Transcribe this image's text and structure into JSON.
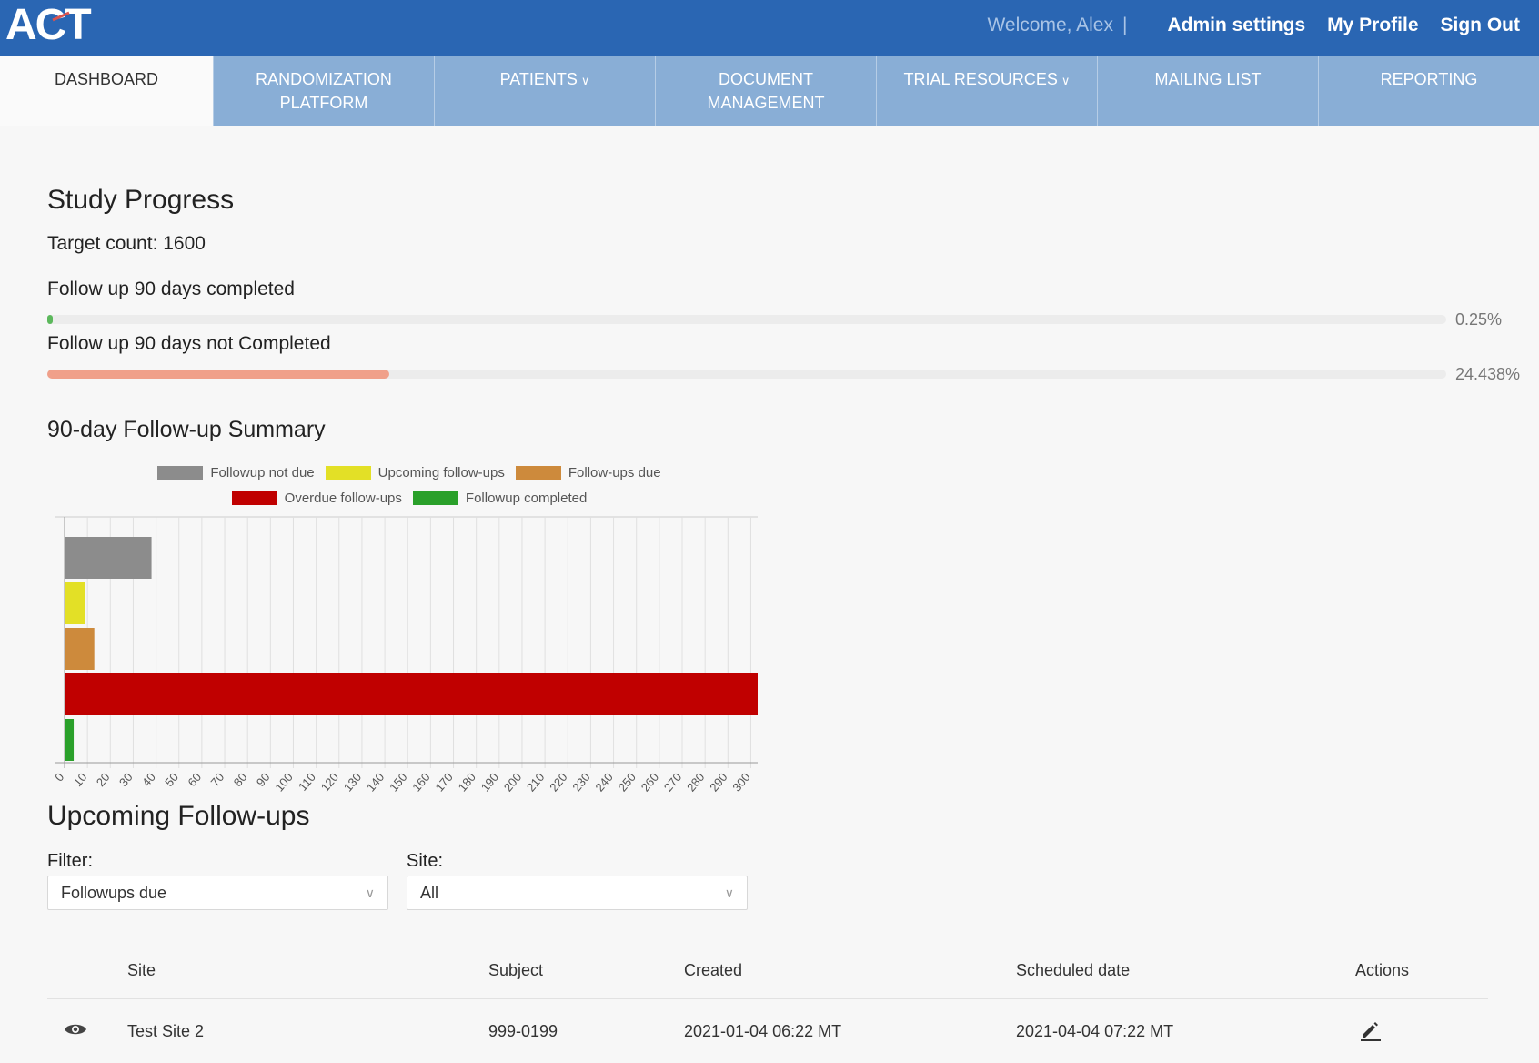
{
  "app": {
    "logo_text": "ACT",
    "welcome": "Welcome, Alex",
    "separator": "|",
    "links": [
      "Admin settings",
      "My Profile",
      "Sign Out"
    ]
  },
  "nav": {
    "items": [
      {
        "label_1": "DASHBOARD",
        "label_2": "",
        "chevron": false,
        "active": true
      },
      {
        "label_1": "RANDOMIZATION",
        "label_2": "PLATFORM",
        "chevron": false,
        "active": false
      },
      {
        "label_1": "PATIENTS",
        "label_2": "",
        "chevron": true,
        "active": false
      },
      {
        "label_1": "DOCUMENT",
        "label_2": "MANAGEMENT",
        "chevron": false,
        "active": false
      },
      {
        "label_1": "TRIAL RESOURCES",
        "label_2": "",
        "chevron": true,
        "active": false
      },
      {
        "label_1": "MAILING LIST",
        "label_2": "",
        "chevron": false,
        "active": false
      },
      {
        "label_1": "REPORTING",
        "label_2": "",
        "chevron": false,
        "active": false
      }
    ]
  },
  "progress": {
    "title": "Study Progress",
    "target": "Target count: 1600",
    "bars": [
      {
        "label": "Follow up 90 days completed",
        "percent": 0.25,
        "percent_text": "0.25%",
        "color": "#5cb85c"
      },
      {
        "label": "Follow up 90 days not Completed",
        "percent": 24.438,
        "percent_text": "24.438%",
        "color": "#f0a08a"
      }
    ]
  },
  "summary": {
    "title": "90-day Follow-up Summary"
  },
  "chart_data": {
    "type": "bar",
    "orientation": "horizontal",
    "categories": [
      "Followup not due",
      "Upcoming follow-ups",
      "Follow-ups due",
      "Overdue follow-ups",
      "Followup completed"
    ],
    "series": [
      {
        "name": "Followup not due",
        "values": [
          38
        ],
        "color": "#8c8c8c"
      },
      {
        "name": "Upcoming follow-ups",
        "values": [
          9
        ],
        "color": "#e3e026"
      },
      {
        "name": "Follow-ups due",
        "values": [
          13
        ],
        "color": "#cd8a3c"
      },
      {
        "name": "Overdue follow-ups",
        "values": [
          303
        ],
        "color": "#c00000"
      },
      {
        "name": "Followup completed",
        "values": [
          4
        ],
        "color": "#2aa02a"
      }
    ],
    "xticks": [
      0,
      10,
      20,
      30,
      40,
      50,
      60,
      70,
      80,
      90,
      100,
      110,
      120,
      130,
      140,
      150,
      160,
      170,
      180,
      190,
      200,
      210,
      220,
      230,
      240,
      250,
      260,
      270,
      280,
      290,
      300
    ],
    "xlim": [
      0,
      303
    ],
    "grid": true,
    "legend": "top",
    "title": "",
    "xlabel": "",
    "ylabel": ""
  },
  "upcoming": {
    "title": "Upcoming Follow-ups",
    "filter_label": "Filter:",
    "filter_value": "Followups due",
    "site_label": "Site:",
    "site_value": "All",
    "columns": [
      "Site",
      "Subject",
      "Created",
      "Scheduled date",
      "Actions"
    ],
    "rows": [
      {
        "site": "Test Site 2",
        "subject": "999-0199",
        "created": "2021-01-04 06:22 MT",
        "scheduled": "2021-04-04 07:22 MT"
      }
    ]
  }
}
